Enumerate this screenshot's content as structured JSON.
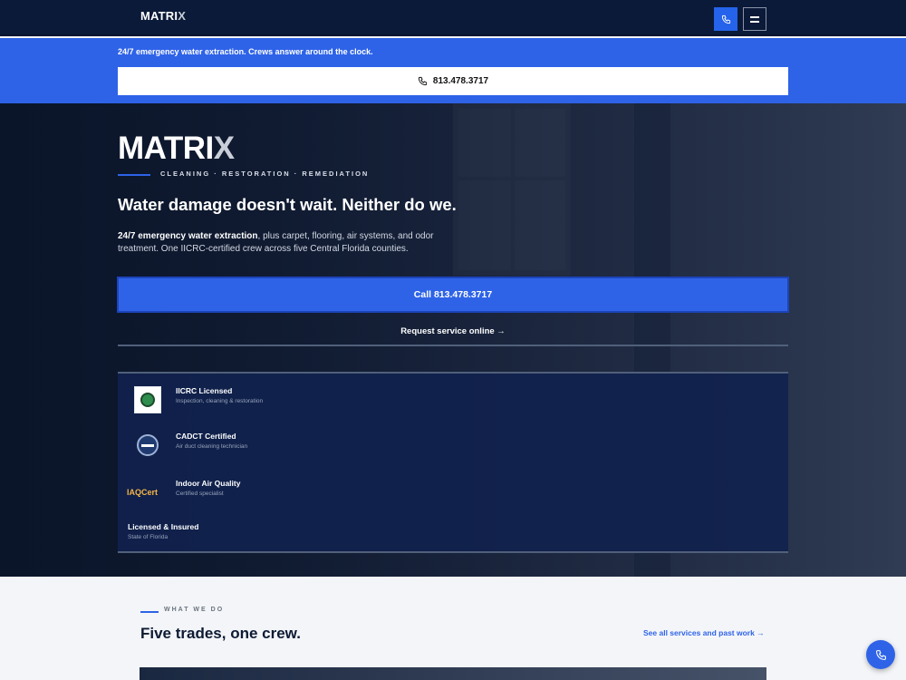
{
  "nav": {
    "logo_main": "MATRI",
    "logo_x": "X"
  },
  "band": {
    "text": "24/7 emergency water extraction. Crews answer around the clock.",
    "phone": "813.478.3717"
  },
  "hero": {
    "logo_main": "MATRI",
    "logo_x": "X",
    "tagline": "CLEANING · RESTORATION · REMEDIATION",
    "headline": "Water damage doesn't wait. Neither do we.",
    "intro_bold": "24/7 emergency water extraction",
    "intro_rest": ", plus carpet, flooring, air systems, and odor treatment. One IICRC-certified crew across five Central Florida counties.",
    "cta_call": "Call 813.478.3717",
    "cta_online": "Request service online →"
  },
  "credentials": [
    {
      "title": "IICRC Licensed",
      "subtitle": "Inspection, cleaning & restoration"
    },
    {
      "title": "CADCT Certified",
      "subtitle": "Air duct cleaning technician"
    },
    {
      "title": "Indoor Air Quality",
      "subtitle": "Certified specialist",
      "badge_text": "IAQCert"
    },
    {
      "title": "Licensed & Insured",
      "subtitle": "State of Florida"
    }
  ],
  "services": {
    "eyebrow": "WHAT WE DO",
    "title": "Five trades, one crew.",
    "see_all": "See all services and past work →"
  },
  "colors": {
    "accent": "#2e63e8",
    "nav_bg": "#0b1a38",
    "creds_bg": "#10224e"
  }
}
